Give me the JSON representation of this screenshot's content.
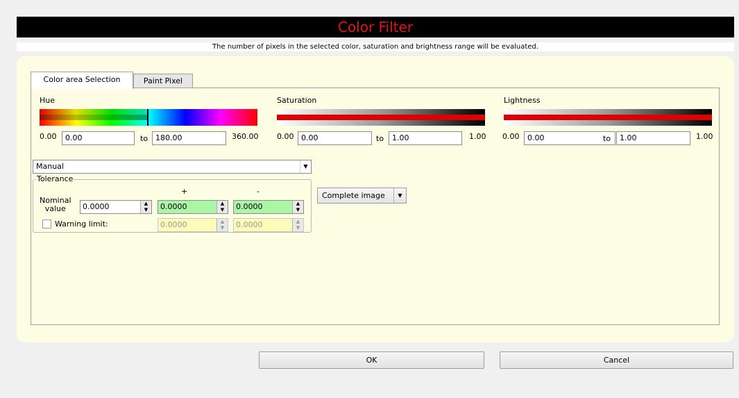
{
  "dialog": {
    "title": "Color Filter",
    "subtitle": "The number of pixels in the selected color, saturation and brightness range will be evaluated."
  },
  "tabs": [
    {
      "label": "Color area Selection",
      "active": true
    },
    {
      "label": "Paint Pixel",
      "active": false
    }
  ],
  "hue": {
    "label": "Hue",
    "min_label": "0.00",
    "from_value": "0.00",
    "to_label": "to",
    "to_value": "180.00",
    "max_label": "360.00"
  },
  "saturation": {
    "label": "Saturation",
    "min_label": "0.00",
    "from_value": "0.00",
    "to_label": "to",
    "to_value": "1.00",
    "max_label": "1.00"
  },
  "lightness": {
    "label": "Lightness",
    "min_label": "0.00",
    "from_value": "0.00",
    "to_label": "to",
    "to_value": "1.00",
    "max_label": "1.00"
  },
  "mode_select": {
    "value": "Manual"
  },
  "tolerance": {
    "title": "Tolerance",
    "plus_header": "+",
    "minus_header": "-",
    "nominal_label_line1": "Nominal",
    "nominal_label_line2": "value",
    "nominal_value": "0.0000",
    "plus_value": "0.0000",
    "minus_value": "0.0000",
    "warning_label": "Warning limit:",
    "warning_checked": false,
    "warning_plus": "0.0000",
    "warning_minus": "0.0000"
  },
  "region_dropdown": {
    "value": "Complete image"
  },
  "buttons": {
    "ok": "OK",
    "cancel": "Cancel"
  },
  "icons": {
    "dropdown": "chevron-down-icon",
    "spinner": "spinner-arrows-icon"
  },
  "colors": {
    "title_bg": "#000000",
    "title_text": "#e81010",
    "panel_bg": "#fdfde3",
    "tolerance_field": "#aaf5a6",
    "warning_field": "#fdfbb8"
  }
}
